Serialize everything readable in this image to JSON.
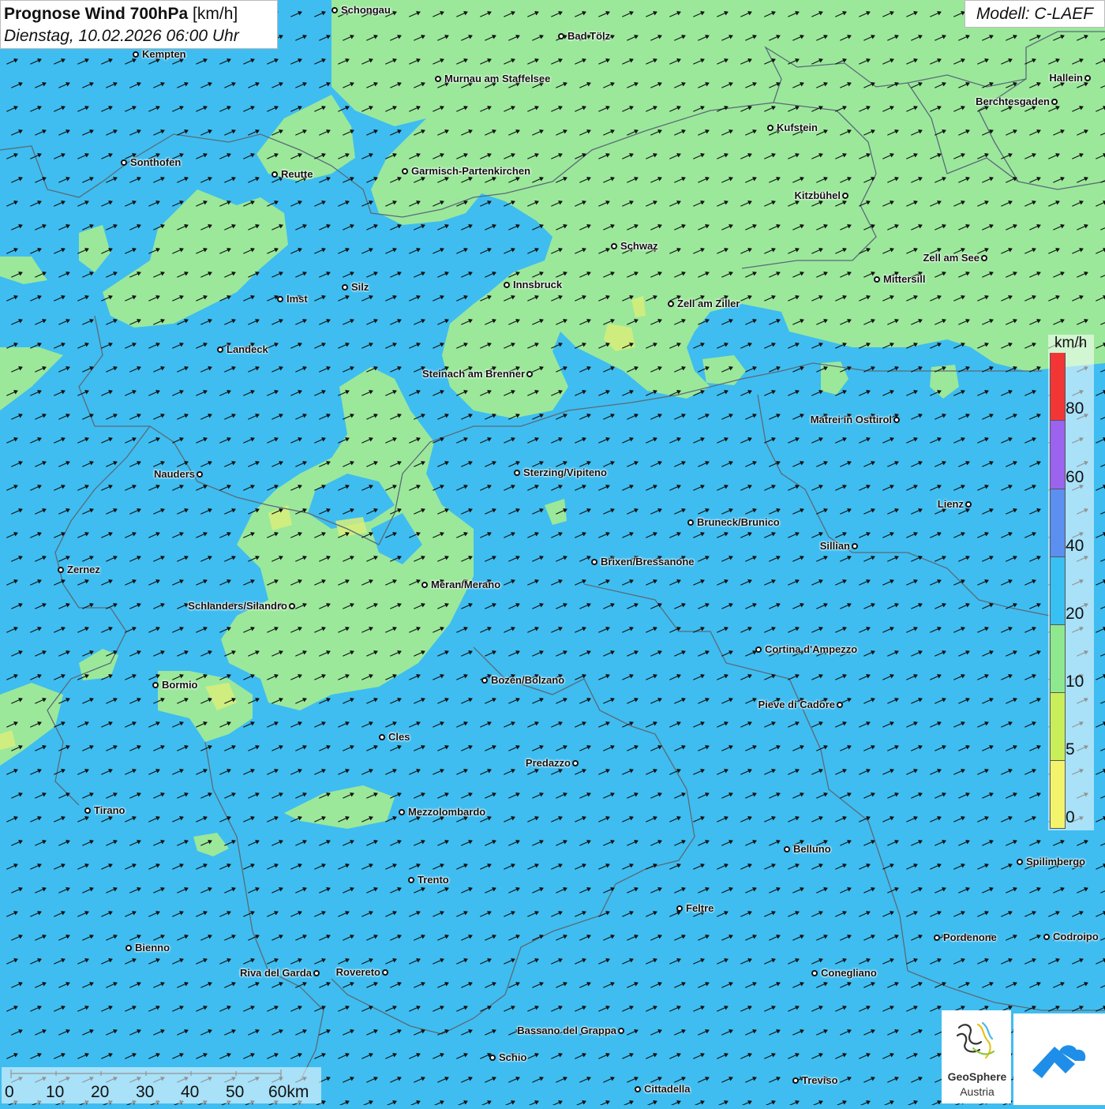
{
  "header": {
    "title_bold": "Prognose Wind 700hPa",
    "title_unit": " [km/h]",
    "datetime": "Dienstag, 10.02.2026 06:00 Uhr",
    "model": "Modell: C-LAEF"
  },
  "colors": {
    "sea_blue": "#3fbdf0",
    "light_green": "#9be89b",
    "yellow_green": "#d8ef7a",
    "border_gray": "#5a6a78",
    "arrow": "#111111"
  },
  "legend": {
    "unit": "km/h",
    "labels": [
      "80",
      "60",
      "40",
      "20",
      "10",
      "5",
      "0"
    ],
    "bands": [
      {
        "from": "0",
        "color": "#f4f46c"
      },
      {
        "from": "5",
        "color": "#c8ef5a"
      },
      {
        "from": "10",
        "color": "#8ee88e"
      },
      {
        "from": "20",
        "color": "#38c0f2"
      },
      {
        "from": "40",
        "color": "#5b8ff0"
      },
      {
        "from": "60",
        "color": "#9b63ee"
      },
      {
        "from": "80",
        "color": "#f23636"
      }
    ]
  },
  "scale": {
    "labels": [
      "0",
      "10",
      "20",
      "30",
      "40",
      "50",
      "60km"
    ]
  },
  "logos": {
    "geosphere_line1": "GeoSphere",
    "geosphere_line2": "Austria"
  },
  "cities": [
    {
      "name": "Schongau",
      "label_side": "right"
    },
    {
      "name": "Bad Tölz",
      "label_side": "right"
    },
    {
      "name": "Kempten",
      "label_side": "right"
    },
    {
      "name": "Murnau am Staffelsee",
      "label_side": "right"
    },
    {
      "name": "Hallein",
      "label_side": "left"
    },
    {
      "name": "Berchtesgaden",
      "label_side": "left"
    },
    {
      "name": "Kufstein",
      "label_side": "right"
    },
    {
      "name": "Sonthofen",
      "label_side": "right"
    },
    {
      "name": "Reutte",
      "label_side": "right"
    },
    {
      "name": "Garmisch-Partenkirchen",
      "label_side": "right"
    },
    {
      "name": "Kitzbühel",
      "label_side": "left"
    },
    {
      "name": "Schwaz",
      "label_side": "right"
    },
    {
      "name": "Zell am See",
      "label_side": "left"
    },
    {
      "name": "Mittersill",
      "label_side": "right"
    },
    {
      "name": "Innsbruck",
      "label_side": "right"
    },
    {
      "name": "Imst",
      "label_side": "right"
    },
    {
      "name": "Silz",
      "label_side": "right"
    },
    {
      "name": "Zell am Ziller",
      "label_side": "right"
    },
    {
      "name": "Landeck",
      "label_side": "right"
    },
    {
      "name": "Steinach am Brenner",
      "label_side": "left"
    },
    {
      "name": "Matrei in Osttirol",
      "label_side": "left"
    },
    {
      "name": "Nauders",
      "label_side": "left"
    },
    {
      "name": "Sterzing/Vipiteno",
      "label_side": "right"
    },
    {
      "name": "Lienz",
      "label_side": "left"
    },
    {
      "name": "Bruneck/Brunico",
      "label_side": "right"
    },
    {
      "name": "Sillian",
      "label_side": "left"
    },
    {
      "name": "Zernez",
      "label_side": "right"
    },
    {
      "name": "Brixen/Bressanone",
      "label_side": "right"
    },
    {
      "name": "Meran/Merano",
      "label_side": "right"
    },
    {
      "name": "Schlanders/Silandro",
      "label_side": "left"
    },
    {
      "name": "Cortina d'Ampezzo",
      "label_side": "right"
    },
    {
      "name": "Bozen/Bolzano",
      "label_side": "right"
    },
    {
      "name": "Bormio",
      "label_side": "right"
    },
    {
      "name": "Pieve di Cadore",
      "label_side": "left"
    },
    {
      "name": "Cles",
      "label_side": "right"
    },
    {
      "name": "Predazzo",
      "label_side": "left"
    },
    {
      "name": "Tirano",
      "label_side": "right"
    },
    {
      "name": "Mezzolombardo",
      "label_side": "right"
    },
    {
      "name": "Belluno",
      "label_side": "right"
    },
    {
      "name": "Spilimbergo",
      "label_side": "right"
    },
    {
      "name": "Trento",
      "label_side": "right"
    },
    {
      "name": "Feltre",
      "label_side": "right"
    },
    {
      "name": "Pordenone",
      "label_side": "right"
    },
    {
      "name": "Codroipo",
      "label_side": "right"
    },
    {
      "name": "Bienno",
      "label_side": "right"
    },
    {
      "name": "Riva del Garda",
      "label_side": "left"
    },
    {
      "name": "Rovereto",
      "label_side": "left"
    },
    {
      "name": "Conegliano",
      "label_side": "right"
    },
    {
      "name": "Bassano del Grappa",
      "label_side": "left"
    },
    {
      "name": "Schio",
      "label_side": "right"
    },
    {
      "name": "Treviso",
      "label_side": "right"
    },
    {
      "name": "Cittadella",
      "label_side": "right"
    }
  ]
}
